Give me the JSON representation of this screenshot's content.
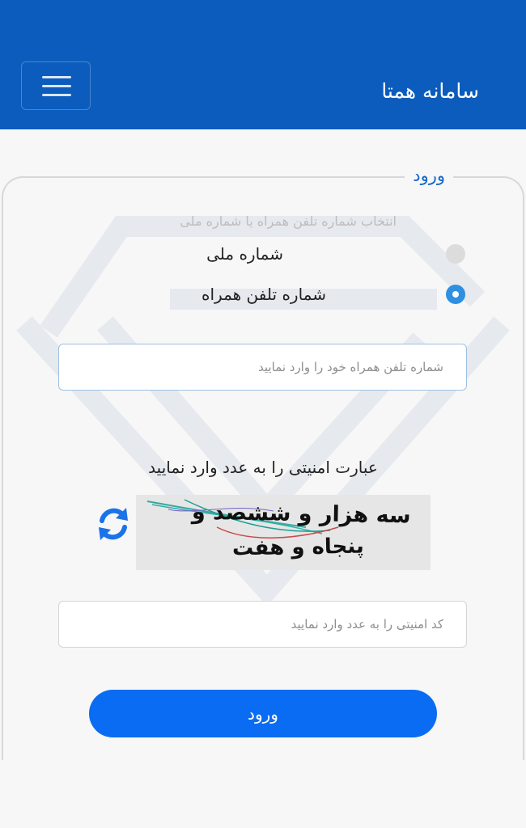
{
  "header": {
    "brand": "سامانه همتا",
    "menu_icon": "hamburger-icon",
    "bg_color": "#0b5cbd"
  },
  "login_form": {
    "legend": "ورود",
    "choice_hint": "انتخاب شماره تلفن همراه یا شماره ملی",
    "options": [
      {
        "label": "شماره ملی",
        "checked": false
      },
      {
        "label": "شماره تلفن همراه",
        "checked": true
      }
    ],
    "phone_input": {
      "value": "",
      "placeholder": "شماره تلفن همراه خود را وارد نمایید"
    },
    "captcha": {
      "title": "عبارت امنیتی را به عدد وارد نمایید",
      "line1": "سه هزار و ششصد و",
      "line2": "پنجاه و هفت",
      "refresh_icon": "refresh-icon"
    },
    "code_input": {
      "value": "",
      "placeholder": "کد امنیتی را به عدد وارد نمایید"
    },
    "submit_label": "ورود",
    "accent_color": "#0a6cf2"
  }
}
